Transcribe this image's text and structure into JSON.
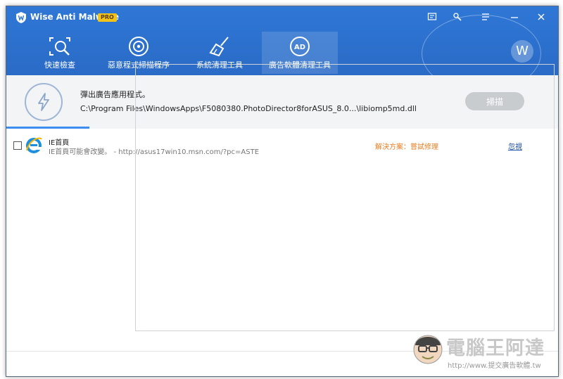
{
  "app": {
    "title": "Wise Anti Malware",
    "badge": "PRO",
    "avatar_letter": "W"
  },
  "titlebar": {
    "icons": [
      "feedback-icon",
      "settings-wrench-icon",
      "menu-icon",
      "minimize-icon",
      "close-icon"
    ]
  },
  "nav": {
    "items": [
      {
        "label": "快速檢查",
        "icon": "quick-scan-icon"
      },
      {
        "label": "惡意程式掃描程序",
        "icon": "target-scan-icon"
      },
      {
        "label": "系統清理工具",
        "icon": "broom-icon"
      },
      {
        "label": "廣告軟體清理工具",
        "icon": "ad-icon",
        "active": true
      }
    ]
  },
  "scan": {
    "title": "彈出廣告應用程式。",
    "path": "C:\\Program Files\\WindowsApps\\F5080380.PhotoDirector8forASUS_8.0...\\libiomp5md.dll",
    "button_label": "掃描",
    "progress": 0.15
  },
  "results": [
    {
      "name": "IE首頁",
      "description": "IE首頁可能會改變。 - http://asus17win10.msn.com/?pc=ASTE",
      "fix": "解決方案：嘗試修理",
      "ignore": "忽視"
    }
  ],
  "watermark": {
    "brand": "電腦王阿達",
    "url": "http://www.提交廣告軟體.tw"
  },
  "colors": {
    "header": "#2f77d6",
    "fix_text": "#e67e22",
    "link": "#1f4fa8",
    "progress": "#3c8df0"
  }
}
